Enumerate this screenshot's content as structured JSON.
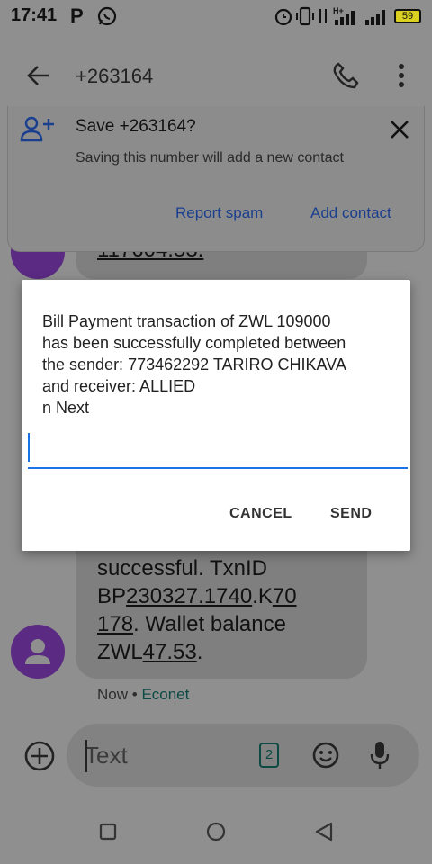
{
  "status_bar": {
    "time": "17:41",
    "battery_level": "59",
    "icons": [
      "p-icon",
      "whatsapp-icon",
      "alarm-icon",
      "vibrate-icon",
      "data-arrows-icon",
      "signal-icon",
      "hplus-signal-icon",
      "battery-icon"
    ]
  },
  "app_bar": {
    "title": "+263164",
    "back_icon": "arrow-back-icon",
    "call_icon": "phone-icon",
    "menu_icon": "more-vert-icon"
  },
  "save_card": {
    "title": "Save +263164?",
    "subtitle": "Saving this number will add a new contact",
    "report_spam": "Report spam",
    "add_contact": "Add contact"
  },
  "messages": {
    "partial_top": "117604.53.",
    "visible_text_line1": "successful. TxnID",
    "visible_text_line2_prefix": "BP",
    "visible_text_line2_link": "230327.1740",
    "visible_text_line2_mid": ".K",
    "visible_text_line2_link2": "70",
    "visible_text_line3_link": "178",
    "visible_text_line3_rest": ". Wallet balance",
    "visible_text_line4_prefix": "ZWL",
    "visible_text_line4_link": "47.53",
    "visible_text_line4_suffix": ".",
    "meta_time": "Now",
    "meta_separator": "•",
    "meta_carrier": "Econet"
  },
  "dialog": {
    "message": "Bill Payment transaction of ZWL 109000\nhas been successfully completed between\nthe sender: 773462292 TARIRO CHIKAVA\nand receiver: ALLIED\nn Next",
    "input_value": "",
    "cancel_label": "CANCEL",
    "send_label": "SEND",
    "accent_color": "#1a73e8"
  },
  "compose": {
    "placeholder": "Text",
    "sim_badge": "2"
  }
}
